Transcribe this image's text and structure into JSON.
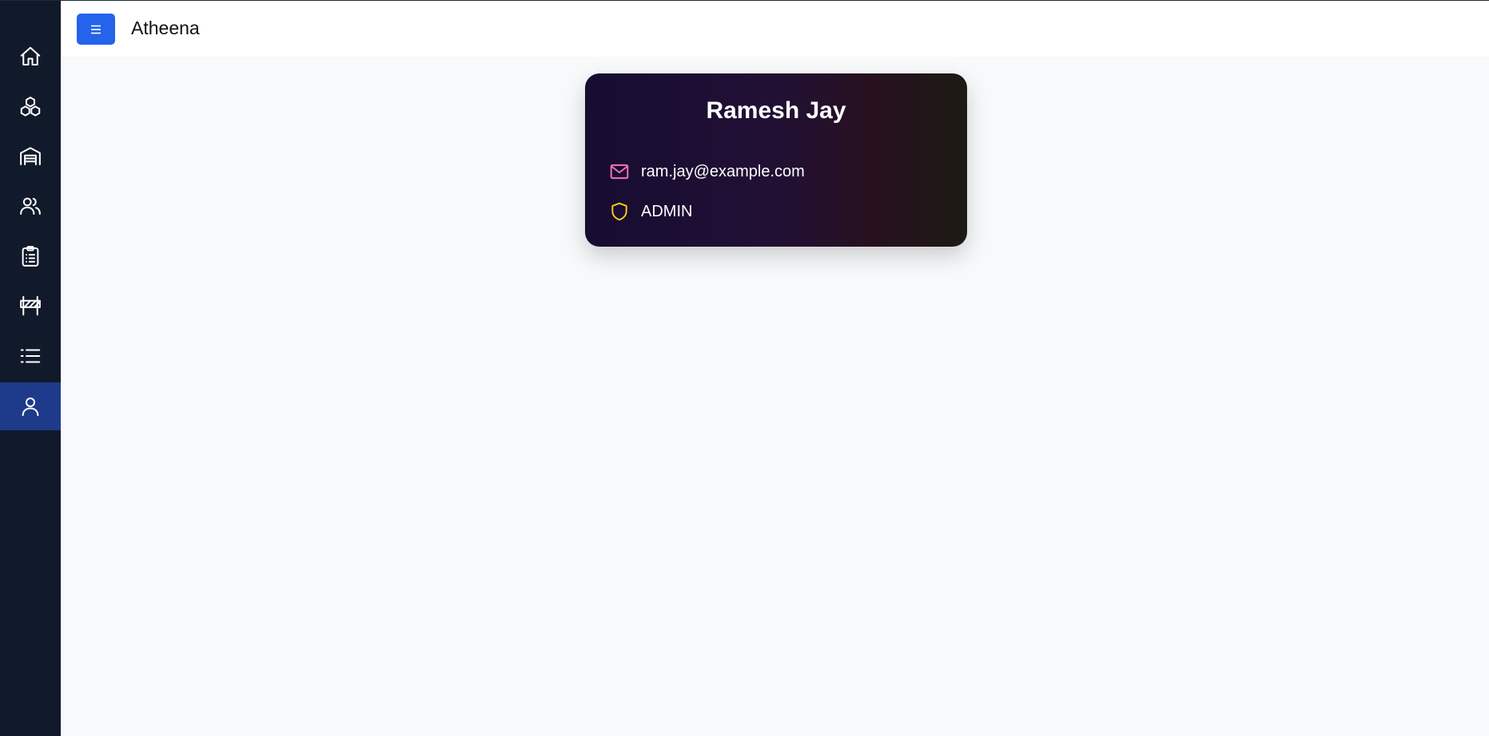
{
  "app": {
    "title": "Atheena"
  },
  "sidebar": {
    "items": [
      {
        "icon": "home-icon",
        "active": false
      },
      {
        "icon": "cubes-icon",
        "active": false
      },
      {
        "icon": "warehouse-icon",
        "active": false
      },
      {
        "icon": "users-icon",
        "active": false
      },
      {
        "icon": "clipboard-list-icon",
        "active": false
      },
      {
        "icon": "road-barrier-icon",
        "active": false
      },
      {
        "icon": "list-icon",
        "active": false
      },
      {
        "icon": "user-icon",
        "active": true
      }
    ]
  },
  "profile": {
    "name": "Ramesh Jay",
    "email": "ram.jay@example.com",
    "role": "ADMIN"
  },
  "colors": {
    "sidebar_bg": "#111a2b",
    "active_item": "#1e3a8a",
    "menu_button": "#2563eb",
    "email_icon": "#f472b6",
    "role_icon": "#facc15"
  }
}
